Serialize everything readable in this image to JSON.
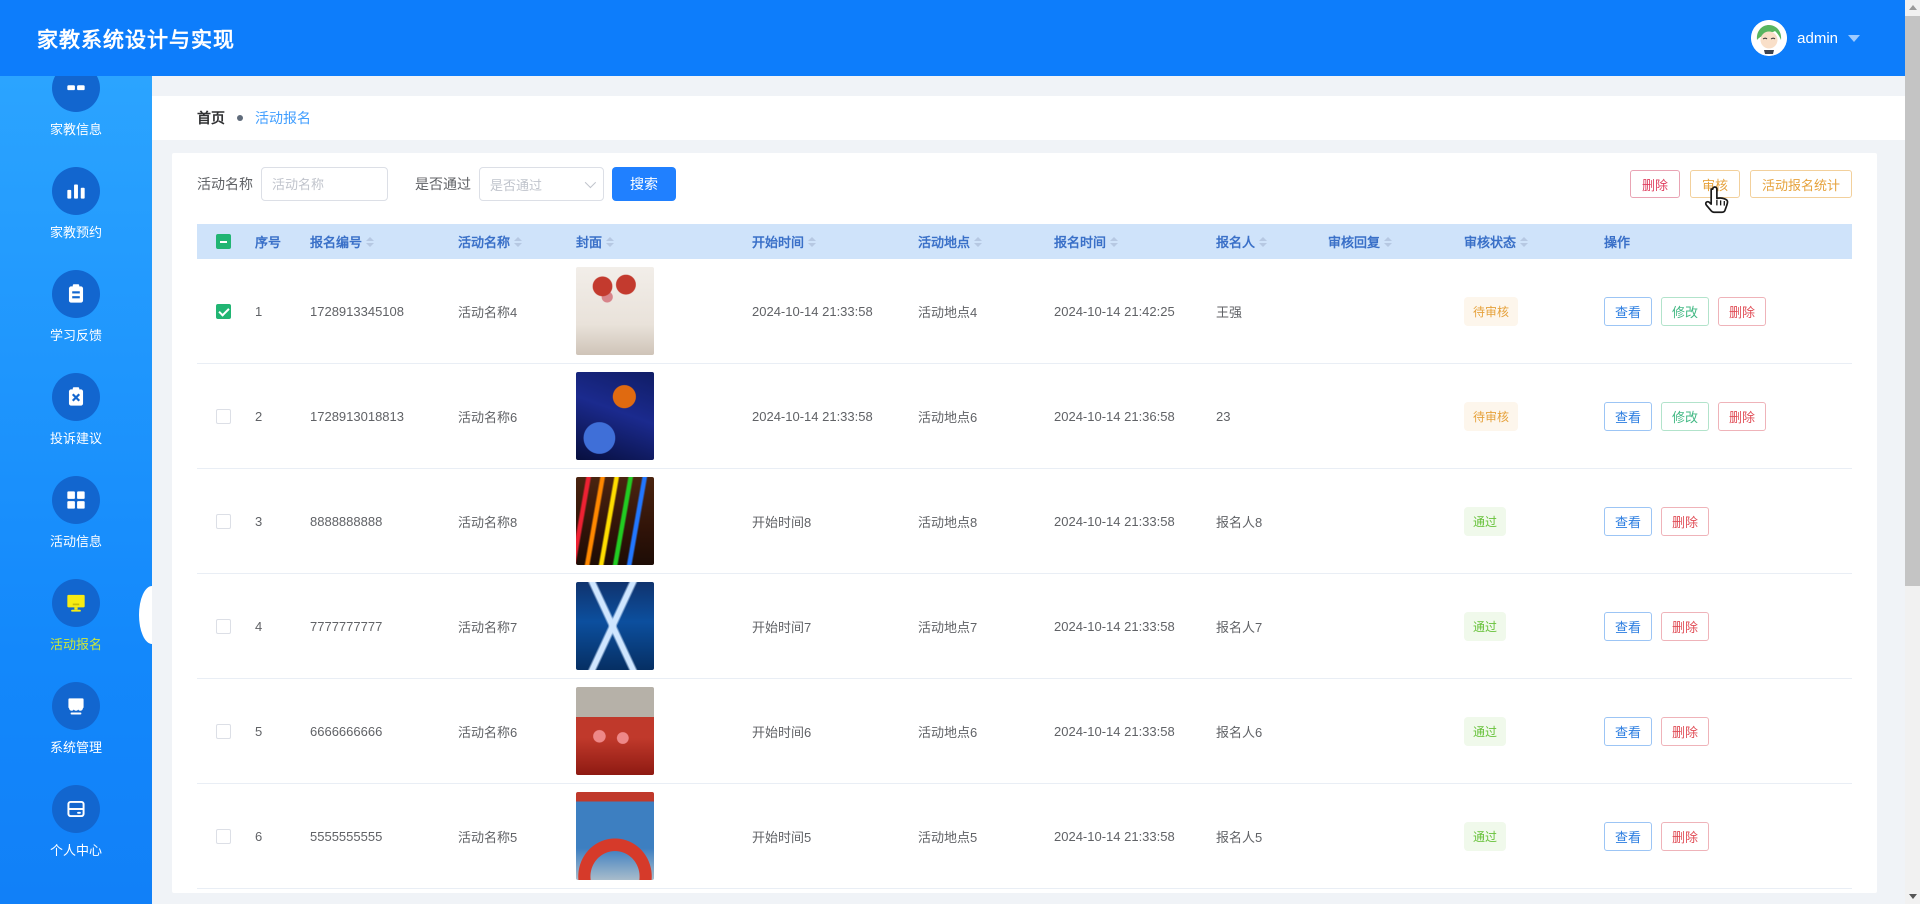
{
  "app": {
    "title": "家教系统设计与实现",
    "user": {
      "name": "admin"
    }
  },
  "sidebar": {
    "items": [
      {
        "label": "家教信息",
        "icon": "tutor-info-icon",
        "active": false
      },
      {
        "label": "家教预约",
        "icon": "tutor-booking-icon",
        "active": false
      },
      {
        "label": "学习反馈",
        "icon": "study-feedback-icon",
        "active": false
      },
      {
        "label": "投诉建议",
        "icon": "complaint-icon",
        "active": false
      },
      {
        "label": "活动信息",
        "icon": "activity-info-icon",
        "active": false
      },
      {
        "label": "活动报名",
        "icon": "activity-signup-icon",
        "active": true
      },
      {
        "label": "系统管理",
        "icon": "system-management-icon",
        "active": false
      },
      {
        "label": "个人中心",
        "icon": "personal-center-icon",
        "active": false
      }
    ]
  },
  "breadcrumb": {
    "home": "首页",
    "current": "活动报名"
  },
  "filters": {
    "name_label": "活动名称",
    "name_placeholder": "活动名称",
    "pass_label": "是否通过",
    "pass_placeholder": "是否通过",
    "search_button": "搜索"
  },
  "toolbar": {
    "delete_button": "删除",
    "audit_button": "审核",
    "stats_button": "活动报名统计"
  },
  "table": {
    "select_all_state": "indeterminate",
    "columns": [
      {
        "label": "序号",
        "sortable": false
      },
      {
        "label": "报名编号",
        "sortable": true
      },
      {
        "label": "活动名称",
        "sortable": true
      },
      {
        "label": "封面",
        "sortable": true
      },
      {
        "label": "开始时间",
        "sortable": true
      },
      {
        "label": "活动地点",
        "sortable": true
      },
      {
        "label": "报名时间",
        "sortable": true
      },
      {
        "label": "报名人",
        "sortable": true
      },
      {
        "label": "审核回复",
        "sortable": true
      },
      {
        "label": "审核状态",
        "sortable": true
      },
      {
        "label": "操作",
        "sortable": false
      }
    ],
    "rows": [
      {
        "seq": "1",
        "code": "1728913345108",
        "name": "活动名称4",
        "cover": "红色爱心气球装饰",
        "start": "2024-10-14 21:33:58",
        "place": "活动地点4",
        "time": "2024-10-14 21:42:25",
        "person": "王强",
        "reply": "",
        "selected": true,
        "status": {
          "label": "待审核",
          "type": "pending"
        },
        "actions": [
          {
            "label": "查看",
            "type": "view"
          },
          {
            "label": "修改",
            "type": "edit"
          },
          {
            "label": "删除",
            "type": "delete"
          }
        ]
      },
      {
        "seq": "2",
        "code": "1728913018813",
        "name": "活动名称6",
        "cover": "蓝色舞台现场",
        "start": "2024-10-14 21:33:58",
        "place": "活动地点6",
        "time": "2024-10-14 21:36:58",
        "person": "23",
        "reply": "",
        "selected": false,
        "status": {
          "label": "待审核",
          "type": "pending"
        },
        "actions": [
          {
            "label": "查看",
            "type": "view"
          },
          {
            "label": "修改",
            "type": "edit"
          },
          {
            "label": "删除",
            "type": "delete"
          }
        ]
      },
      {
        "seq": "3",
        "code": "8888888888",
        "name": "活动名称8",
        "cover": "彩色灯光舞台",
        "start": "开始时间8",
        "place": "活动地点8",
        "time": "2024-10-14 21:33:58",
        "person": "报名人8",
        "reply": "",
        "selected": false,
        "status": {
          "label": "通过",
          "type": "passed"
        },
        "actions": [
          {
            "label": "查看",
            "type": "view"
          },
          {
            "label": "删除",
            "type": "delete"
          }
        ]
      },
      {
        "seq": "4",
        "code": "7777777777",
        "name": "活动名称7",
        "cover": "蓝色灯光通道",
        "start": "开始时间7",
        "place": "活动地点7",
        "time": "2024-10-14 21:33:58",
        "person": "报名人7",
        "reply": "",
        "selected": false,
        "status": {
          "label": "通过",
          "type": "passed"
        },
        "actions": [
          {
            "label": "查看",
            "type": "view"
          },
          {
            "label": "删除",
            "type": "delete"
          }
        ]
      },
      {
        "seq": "5",
        "code": "6666666666",
        "name": "活动名称6",
        "cover": "红色庆典气球",
        "start": "开始时间6",
        "place": "活动地点6",
        "time": "2024-10-14 21:33:58",
        "person": "报名人6",
        "reply": "",
        "selected": false,
        "status": {
          "label": "通过",
          "type": "passed"
        },
        "actions": [
          {
            "label": "查看",
            "type": "view"
          },
          {
            "label": "删除",
            "type": "delete"
          }
        ]
      },
      {
        "seq": "6",
        "code": "5555555555",
        "name": "活动名称5",
        "cover": "红色拱门蓝天",
        "start": "开始时间5",
        "place": "活动地点5",
        "time": "2024-10-14 21:33:58",
        "person": "报名人5",
        "reply": "",
        "selected": false,
        "status": {
          "label": "通过",
          "type": "passed"
        },
        "actions": [
          {
            "label": "查看",
            "type": "view"
          },
          {
            "label": "删除",
            "type": "delete"
          }
        ]
      }
    ]
  },
  "colors": {
    "primary": "#0d7dfb",
    "sidebar_top": "#2ba4ff",
    "sidebar_bottom": "#1180f8",
    "active_item": "#cde83a",
    "table_header_bg": "#cfe3fa",
    "table_header_text": "#3a70c8",
    "pending_text": "#e6a23c",
    "pending_bg": "#fdf6ec",
    "passed_text": "#67c23a",
    "passed_bg": "#f0f9eb",
    "delete_red": "#df3d5e",
    "audit_orange": "#e6a23c",
    "search_blue": "#2080ff",
    "checkbox_green": "#21b573"
  }
}
